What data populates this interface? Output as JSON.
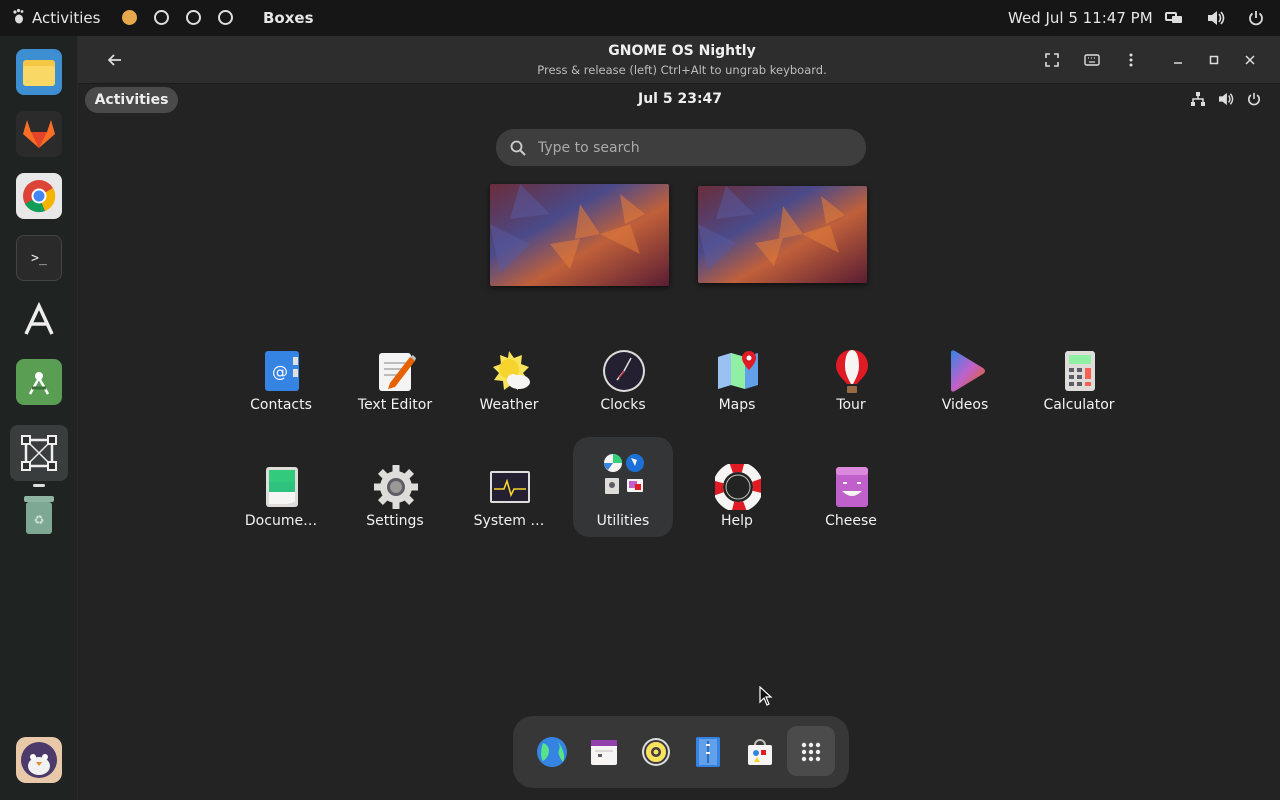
{
  "host": {
    "activities_label": "Activities",
    "app_title": "Boxes",
    "clock": "Wed Jul 5  11:47 PM",
    "tray_icons": [
      "network-icon",
      "volume-icon",
      "power-icon"
    ],
    "workspaces": [
      {
        "active": true,
        "color": "#e5a84b"
      },
      {
        "active": false
      },
      {
        "active": false
      },
      {
        "active": false
      }
    ],
    "dock_apps": [
      "files",
      "gitlab",
      "chrome",
      "terminal",
      "text-a",
      "android-studio",
      "boxes",
      "trash",
      "mascot"
    ]
  },
  "window": {
    "title": "GNOME OS Nightly",
    "subtitle": "Press & release (left) Ctrl+Alt to ungrab keyboard."
  },
  "guest": {
    "activities_label": "Activities",
    "clock": "Jul 5  23:47",
    "search": {
      "placeholder": "Type to search",
      "value": ""
    },
    "apps": [
      {
        "label": "Contacts",
        "icon": "contacts-icon"
      },
      {
        "label": "Text Editor",
        "icon": "text-editor-icon"
      },
      {
        "label": "Weather",
        "icon": "weather-icon"
      },
      {
        "label": "Clocks",
        "icon": "clocks-icon"
      },
      {
        "label": "Maps",
        "icon": "maps-icon"
      },
      {
        "label": "Tour",
        "icon": "tour-icon"
      },
      {
        "label": "Videos",
        "icon": "videos-icon"
      },
      {
        "label": "Calculator",
        "icon": "calculator-icon"
      },
      {
        "label": "Docume…",
        "icon": "document-scanner-icon"
      },
      {
        "label": "Settings",
        "icon": "settings-icon"
      },
      {
        "label": "System …",
        "icon": "system-monitor-icon"
      },
      {
        "label": "Utilities",
        "icon": "utilities-folder-icon",
        "selected": true
      },
      {
        "label": "Help",
        "icon": "help-icon"
      },
      {
        "label": "Cheese",
        "icon": "cheese-icon"
      }
    ],
    "dock": [
      "web-browser-icon",
      "calendar-icon",
      "rhythmbox-icon",
      "files-icon",
      "software-icon",
      "show-apps-icon"
    ]
  },
  "colors": {
    "host_bar": "#161616",
    "window_header": "#2d2d2d",
    "guest_bg": "#232323",
    "accent_yellow": "#e5a84b"
  }
}
